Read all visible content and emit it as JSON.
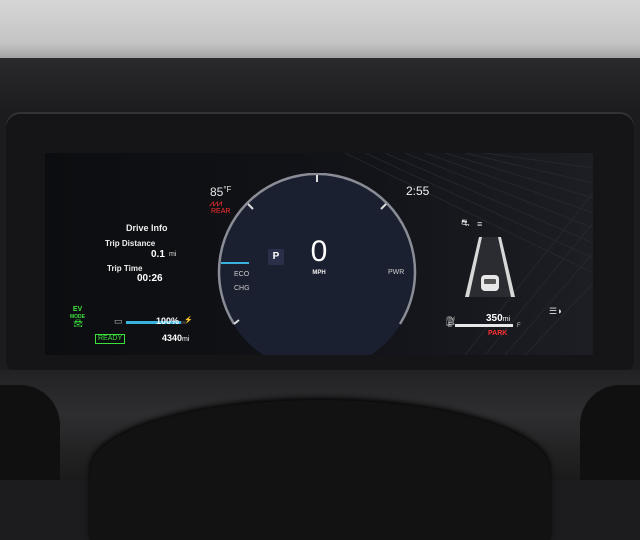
{
  "climate": {
    "temperature": "85",
    "temp_unit": "°F",
    "rear_label": "REAR"
  },
  "trip": {
    "title": "Drive Info",
    "distance_label": "Trip Distance",
    "distance_value": "0.1",
    "distance_unit": "mi",
    "time_label": "Trip Time",
    "time_value": "00:26"
  },
  "ev_status": {
    "mode_line1": "EV",
    "mode_line2": "MODE",
    "ready_label": "READY",
    "battery_percent": "100",
    "battery_percent_unit": "%",
    "battery_fill": 0.92,
    "range_value": "4340",
    "range_unit": "mi"
  },
  "gauge": {
    "gear": "P",
    "speed": "0",
    "speed_unit": "MPH",
    "eco_label": "ECO",
    "chg_label": "CHG",
    "pwr_label": "PWR"
  },
  "clock": "2:55",
  "fuel": {
    "empty_label": "E",
    "full_label": "F",
    "level": 1.0,
    "range_value": "350",
    "range_unit": "mi",
    "park_label": "PARK"
  },
  "colors": {
    "warning": "#ff3030",
    "ev_green": "#3be03b",
    "battery_blue": "#3ab2e0",
    "gauge_bg": "#1b2030"
  },
  "icons": [
    "rear-seat-heater-icon",
    "ev-car-icon",
    "battery-icon",
    "plug-icon",
    "driver-assist-icon",
    "lane-keep-icon",
    "fuel-pump-icon",
    "headlight-icon"
  ]
}
